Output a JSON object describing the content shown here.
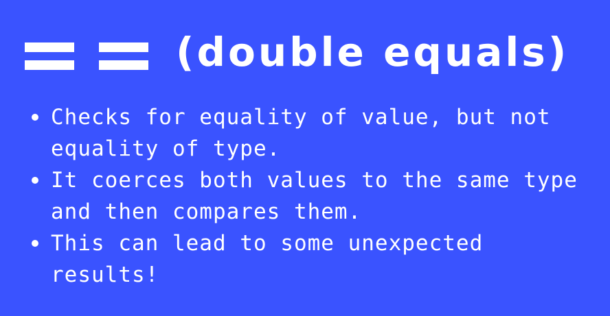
{
  "title": {
    "symbol": "==",
    "text": "(double equals)"
  },
  "bullets": [
    {
      "text": "Checks for equality of value, but not equality of type."
    },
    {
      "text": "It coerces both values to the same type and then compares them."
    },
    {
      "text": "This can lead to some unexpected results!"
    }
  ],
  "colors": {
    "background": "#3a53ff",
    "text": "#ffffff"
  }
}
